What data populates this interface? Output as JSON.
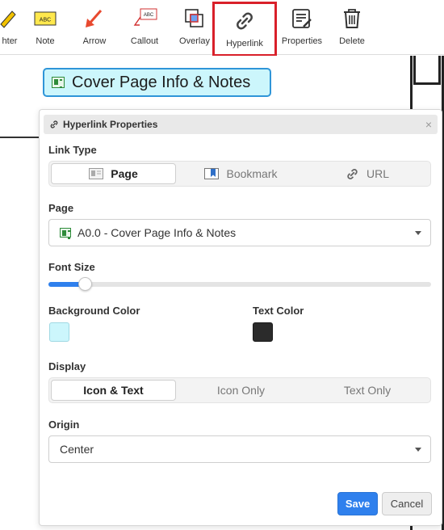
{
  "toolbar": {
    "items": [
      {
        "label": "hter",
        "icon": "highlighter-icon"
      },
      {
        "label": "Note",
        "icon": "note-icon",
        "icon_text": "ABC"
      },
      {
        "label": "Arrow",
        "icon": "arrow-icon"
      },
      {
        "label": "Callout",
        "icon": "callout-icon",
        "icon_text": "ABC"
      },
      {
        "label": "Overlay",
        "icon": "overlay-icon"
      },
      {
        "label": "Hyperlink",
        "icon": "hyperlink-icon"
      },
      {
        "label": "Properties",
        "icon": "properties-icon"
      },
      {
        "label": "Delete",
        "icon": "trash-icon"
      }
    ],
    "highlight_color": "#d9202a"
  },
  "canvas": {
    "link_chip": {
      "text": "Cover Page Info & Notes",
      "background": "#ccf6fc",
      "border": "#2f95d8"
    }
  },
  "panel": {
    "title": "Hyperlink Properties",
    "close_glyph": "×",
    "link_type": {
      "label": "Link Type",
      "options": [
        {
          "label": "Page",
          "icon": "page-icon",
          "selected": true
        },
        {
          "label": "Bookmark",
          "icon": "bookmark-icon",
          "selected": false
        },
        {
          "label": "URL",
          "icon": "link-icon",
          "selected": false
        }
      ]
    },
    "page": {
      "label": "Page",
      "value": "A0.0 - Cover Page Info & Notes"
    },
    "font_size": {
      "label": "Font Size",
      "slider_fraction": 0.095
    },
    "background_color": {
      "label": "Background Color",
      "value": "#ccf6fc"
    },
    "text_color": {
      "label": "Text Color",
      "value": "#2b2b2b"
    },
    "display": {
      "label": "Display",
      "options": [
        {
          "label": "Icon & Text",
          "selected": true
        },
        {
          "label": "Icon Only",
          "selected": false
        },
        {
          "label": "Text Only",
          "selected": false
        }
      ]
    },
    "origin": {
      "label": "Origin",
      "value": "Center"
    },
    "buttons": {
      "save": "Save",
      "cancel": "Cancel"
    },
    "accent": "#2f80ed"
  }
}
